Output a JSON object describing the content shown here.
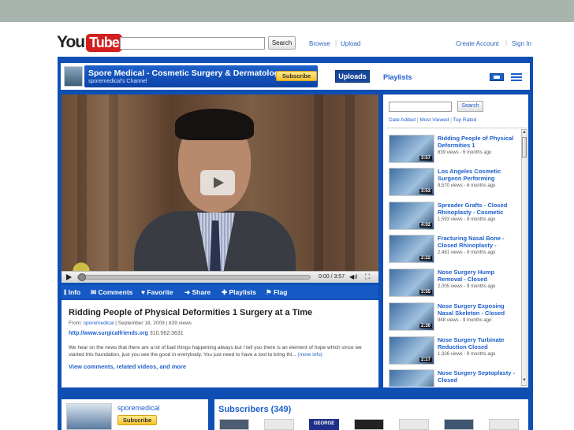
{
  "header": {
    "logo_you": "You",
    "logo_tube": "Tube",
    "search_button": "Search",
    "nav_browse": "Browse",
    "nav_upload": "Upload",
    "nav_sep": "|",
    "create_account": "Create Account",
    "sign_in": "Sign In"
  },
  "channel": {
    "title": "Spore Medical - Cosmetic Surgery & Dermatology",
    "subtitle": "sporemedical's Channel",
    "subscribe": "Subscribe",
    "uploads": "Uploads",
    "playlists": "Playlists"
  },
  "player": {
    "time": "0:00 / 3:57",
    "volume_icon": "speaker-icon",
    "fullscreen_icon": "fullscreen-icon",
    "fullscreen_glyph": "⛶",
    "volume_glyph": "◀ıl"
  },
  "actions": [
    {
      "label": "ℹ Info"
    },
    {
      "label": "✉ Comments"
    },
    {
      "label": "♥ Favorite"
    },
    {
      "label": "➜ Share"
    },
    {
      "label": "✚ Playlists"
    },
    {
      "label": "⚑ Flag"
    }
  ],
  "video": {
    "title": "Ridding People of Physical Deformities 1 Surgery at a Time",
    "from_label": "From:",
    "from_user": "sporemedical",
    "meta_rest": "| September 18, 2009 | 839 views",
    "url": "http://www.surgicalfriends.org",
    "phone": "310.562.3631",
    "description": "We hear on the news that there are a lot of bad things happening always but I tell you there is an element of hope which since we started this foundation, just you see the good in everybody. You just need to have a tool to bring thi...",
    "more_info": "(more info)",
    "view_more": "View comments, related videos, and more"
  },
  "sidebar": {
    "search_button": "Search",
    "sort_date": "Date Added",
    "sort_viewed": "Most Viewed",
    "sort_rated": "Top Rated",
    "sort_sep": "|",
    "scroll_up": "▲",
    "scroll_down": "▼",
    "videos": [
      {
        "title": "Ridding People of Physical Deformities 1",
        "stats": "839 views - 6 months ago",
        "duration": "3:57"
      },
      {
        "title": "Los Angeles Cosmetic Surgeon Performing",
        "stats": "9,570 views - 6 months ago",
        "duration": "3:53"
      },
      {
        "title": "Spreader Grafts - Closed Rhinoplasty - Cosmetic",
        "stats": "1,593 views - 9 months ago",
        "duration": "4:02"
      },
      {
        "title": "Fracturing Nasal Bone - Closed Rhinoplasty -",
        "stats": "2,461 views - 9 months ago",
        "duration": "2:22"
      },
      {
        "title": "Nose Surgery Hump Removal - Closed",
        "stats": "2,005 views - 9 months ago",
        "duration": "3:55"
      },
      {
        "title": "Nose Surgery Exposing Nasal Skeleton - Closed",
        "stats": "948 views - 9 months ago",
        "duration": "2:36"
      },
      {
        "title": "Nose Surgery Turbinate Reduction Closed",
        "stats": "1,326 views - 9 months ago",
        "duration": "2:17"
      },
      {
        "title": "Nose Surgery Septoplasty - Closed",
        "stats": "",
        "duration": ""
      }
    ]
  },
  "profile": {
    "name": "sporemedical",
    "subscribe": "Subscribe"
  },
  "subscribers": {
    "title": "Subscribers (349)",
    "george": "GEORGE"
  }
}
